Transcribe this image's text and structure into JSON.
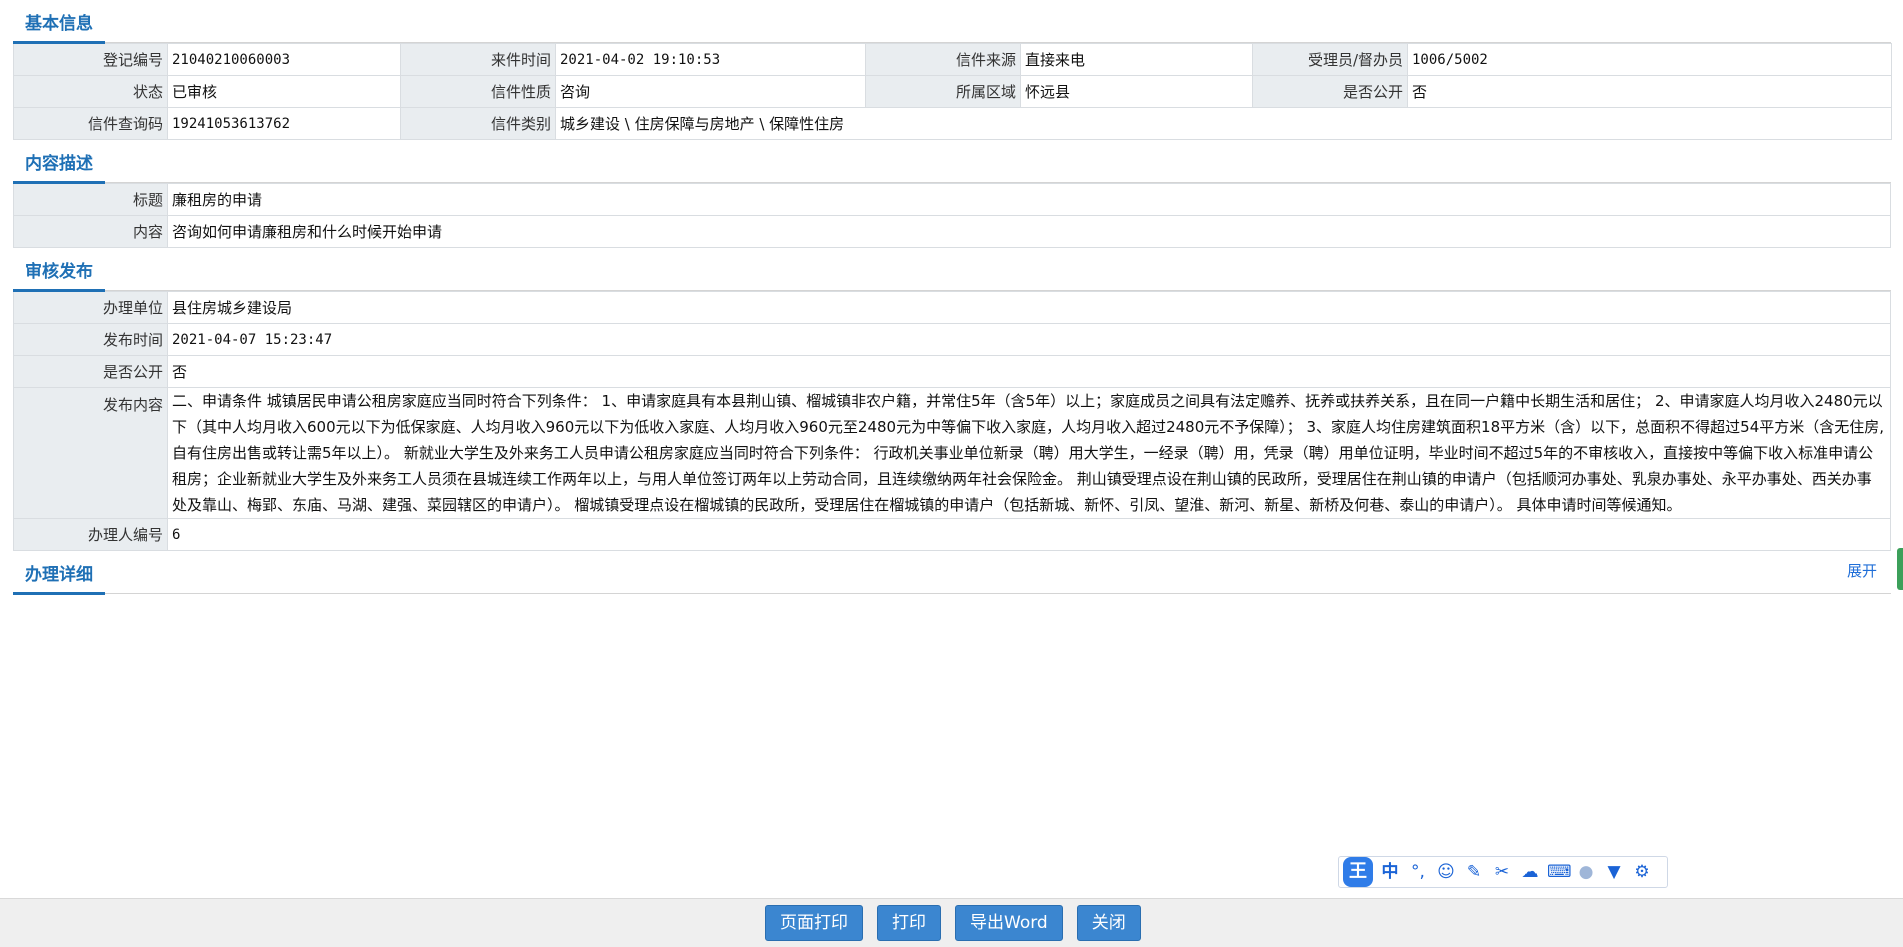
{
  "sections": {
    "basic": "基本信息",
    "content": "内容描述",
    "review": "审核发布",
    "detail": "办理详细"
  },
  "basic_info": {
    "reg_no_label": "登记编号",
    "reg_no": "21040210060003",
    "arrival_label": "来件时间",
    "arrival": "2021-04-02 19:10:53",
    "source_label": "信件来源",
    "source": "直接来电",
    "handler_label": "受理员/督办员",
    "handler": "1006/5002",
    "status_label": "状态",
    "status": "已审核",
    "nature_label": "信件性质",
    "nature": "咨询",
    "region_label": "所属区域",
    "region": "怀远县",
    "public_label": "是否公开",
    "public": "否",
    "query_label": "信件查询码",
    "query": "19241053613762",
    "category_label": "信件类别",
    "category": "城乡建设 \\ 住房保障与房地产 \\ 保障性住房"
  },
  "content_desc": {
    "title_label": "标题",
    "title": "廉租房的申请",
    "content_label": "内容",
    "content": "咨询如何申请廉租房和什么时候开始申请"
  },
  "review_publish": {
    "unit_label": "办理单位",
    "unit": "县住房城乡建设局",
    "time_label": "发布时间",
    "time": "2021-04-07 15:23:47",
    "public_label": "是否公开",
    "public": "否",
    "publish_content_label": "发布内容",
    "publish_content": "二、申请条件 城镇居民申请公租房家庭应当同时符合下列条件： 1、申请家庭具有本县荆山镇、榴城镇非农户籍，并常住5年（含5年）以上；家庭成员之间具有法定赡养、抚养或扶养关系，且在同一户籍中长期生活和居住； 2、申请家庭人均月收入2480元以下（其中人均月收入600元以下为低保家庭、人均月收入960元以下为低收入家庭、人均月收入960元至2480元为中等偏下收入家庭，人均月收入超过2480元不予保障）； 3、家庭人均住房建筑面积18平方米（含）以下，总面积不得超过54平方米（含无住房,自有住房出售或转让需5年以上）。 新就业大学生及外来务工人员申请公租房家庭应当同时符合下列条件： 行政机关事业单位新录（聘）用大学生，一经录（聘）用，凭录（聘）用单位证明，毕业时间不超过5年的不审核收入，直接按中等偏下收入标准申请公租房；企业新就业大学生及外来务工人员须在县城连续工作两年以上，与用人单位签订两年以上劳动合同，且连续缴纳两年社会保险金。 荆山镇受理点设在荆山镇的民政所，受理居住在荆山镇的申请户（包括顺河办事处、乳泉办事处、永平办事处、西关办事处及靠山、梅郢、东庙、马湖、建强、菜园辖区的申请户）。 榴城镇受理点设在榴城镇的民政所，受理居住在榴城镇的申请户（包括新城、新怀、引凤、望淮、新河、新星、新桥及何巷、泰山的申请户）。 具体申请时间等候通知。",
    "handler_no_label": "办理人编号",
    "handler_no": "6"
  },
  "detail": {
    "toggle_label": "展开"
  },
  "footer": {
    "page_print": "页面打印",
    "print": "打印",
    "export_word": "导出Word",
    "close": "关闭"
  },
  "ime_toolbar": {
    "logo": "王",
    "zh": "中",
    "icons": [
      "punct-icon",
      "emoji-icon",
      "pen-icon",
      "scissors-icon",
      "cloud-icon",
      "keyboard-icon",
      "user-icon",
      "shirt-icon",
      "gear-icon"
    ]
  }
}
